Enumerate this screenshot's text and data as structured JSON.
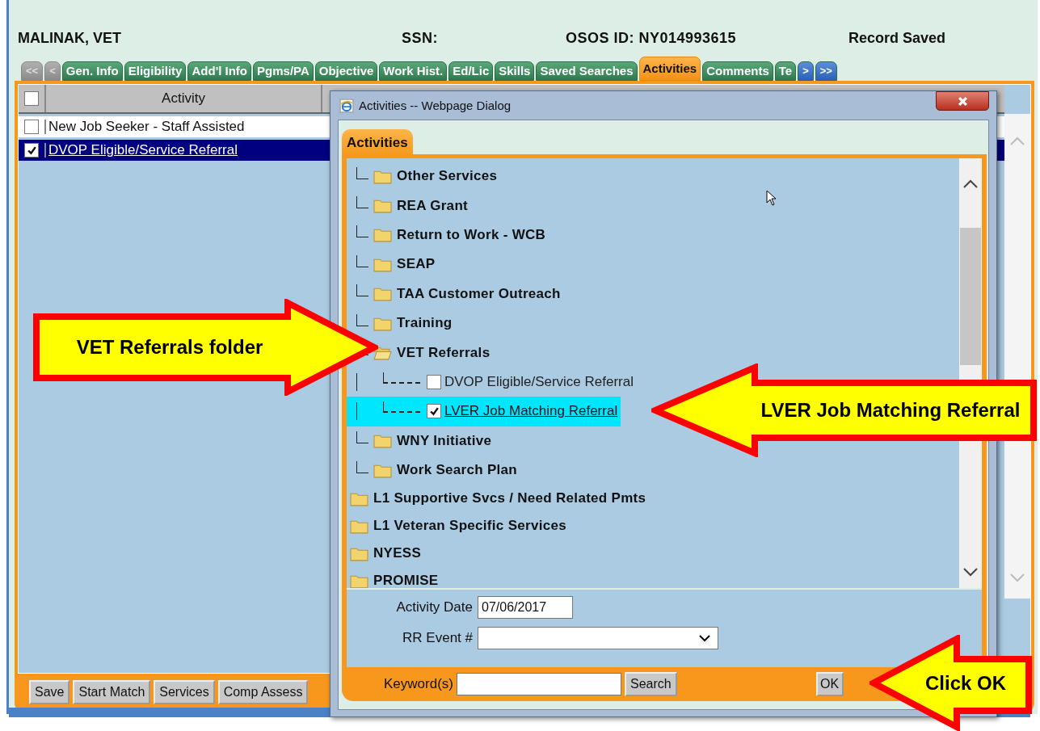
{
  "header": {
    "name": "MALINAK, VET",
    "ssn_label": "SSN:",
    "osos_id": "OSOS ID: NY014993615",
    "status": "Record Saved"
  },
  "tab_nav_left": [
    {
      "label": "<<",
      "disabled": true
    },
    {
      "label": "<",
      "disabled": true
    }
  ],
  "tabs": [
    {
      "label": "Gen. Info",
      "selected": false
    },
    {
      "label": "Eligibility",
      "selected": false
    },
    {
      "label": "Add'l Info",
      "selected": false
    },
    {
      "label": "Pgms/PA",
      "selected": false
    },
    {
      "label": "Objective",
      "selected": false
    },
    {
      "label": "Work Hist.",
      "selected": false
    },
    {
      "label": "Ed/Lic",
      "selected": false
    },
    {
      "label": "Skills",
      "selected": false
    },
    {
      "label": "Saved Searches",
      "selected": false
    },
    {
      "label": "Activities",
      "selected": true
    },
    {
      "label": "Comments",
      "selected": false
    },
    {
      "label": "Te",
      "selected": false
    }
  ],
  "tab_nav_right": [
    {
      "label": ">",
      "disabled": false
    },
    {
      "label": ">>",
      "disabled": false
    }
  ],
  "activity_table": {
    "column": "Activity",
    "select_all_checked": false,
    "rows": [
      {
        "label": "New Job Seeker - Staff Assisted",
        "checked": false,
        "selected": false
      },
      {
        "label": "DVOP Eligible/Service Referral",
        "checked": true,
        "selected": true
      }
    ]
  },
  "buttons": [
    "Save",
    "Start Match",
    "Services",
    "Comp Assess"
  ],
  "dialog": {
    "title": "Activities -- Webpage Dialog",
    "tab": "Activities",
    "tree": {
      "branch_items": [
        {
          "label": "Other Services",
          "expanded": false
        },
        {
          "label": "REA Grant",
          "expanded": false
        },
        {
          "label": "Return to Work - WCB",
          "expanded": false
        },
        {
          "label": "SEAP",
          "expanded": false
        },
        {
          "label": "TAA Customer Outreach",
          "expanded": false
        },
        {
          "label": "Training",
          "expanded": false
        },
        {
          "label": "VET Referrals",
          "expanded": true,
          "children": [
            {
              "label": "DVOP Eligible/Service Referral",
              "checked": false,
              "selected": false
            },
            {
              "label": "LVER Job Matching Referral",
              "checked": true,
              "selected": true
            }
          ]
        },
        {
          "label": "WNY Initiative",
          "expanded": false
        },
        {
          "label": "Work Search Plan",
          "expanded": false
        }
      ],
      "root_items": [
        {
          "label": "L1 Supportive Svcs / Need Related Pmts",
          "expanded": false
        },
        {
          "label": "L1 Veteran Specific Services",
          "expanded": false
        },
        {
          "label": "NYESS",
          "expanded": false
        },
        {
          "label": "PROMISE",
          "expanded": false
        }
      ]
    },
    "activity_date": {
      "label": "Activity Date",
      "value": "07/06/2017"
    },
    "rr_event": {
      "label": "RR Event #"
    },
    "keyword": {
      "label": "Keyword(s)"
    },
    "search_button": "Search",
    "ok_button": "OK"
  },
  "callouts": [
    {
      "text": "VET Referrals folder",
      "kind": "right-arrow"
    },
    {
      "text": "LVER Job Matching Referral",
      "kind": "left-arrow"
    },
    {
      "text": "Click OK",
      "kind": "left-arrow"
    }
  ]
}
